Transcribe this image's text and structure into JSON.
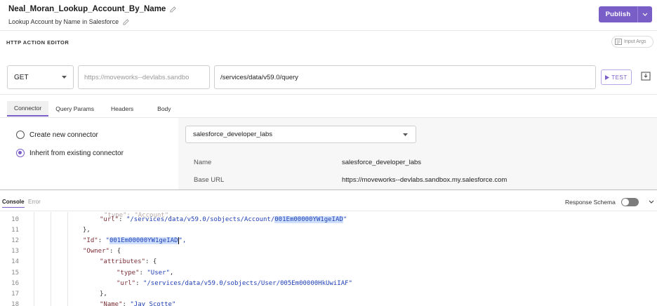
{
  "header": {
    "title": "Neal_Moran_Lookup_Account_By_Name",
    "subtitle": "Lookup Account by Name in Salesforce",
    "publish_label": "Publish"
  },
  "editor": {
    "label": "HTTP ACTION EDITOR",
    "input_args_label": "Input Args",
    "method": "GET",
    "base_url": "https://moveworks--devlabs.sandbo",
    "path": "/services/data/v59.0/query",
    "test_label": "TEST"
  },
  "tabs": [
    "Connector",
    "Query Params",
    "Headers",
    "Body"
  ],
  "connector": {
    "option_new": "Create new connector",
    "option_existing": "Inherit from existing connector",
    "selected_connector": "salesforce_developer_labs",
    "fields": [
      {
        "key": "Name",
        "value": "salesforce_developer_labs"
      },
      {
        "key": "Base URL",
        "value": "https://moveworks--devlabs.sandbox.my.salesforce.com"
      }
    ]
  },
  "console": {
    "tab_console": "Console",
    "tab_error": "Error",
    "response_schema_label": "Response Schema",
    "lines": [
      {
        "n": "10",
        "indent": 2,
        "key": "\"url\"",
        "sep": ": ",
        "val": "\"/services/data/v59.0/sobjects/Account/",
        "hl": "001Em00000YW1geIAD",
        "tail": "\""
      },
      {
        "n": "11",
        "indent": 1,
        "punct": "},"
      },
      {
        "n": "12",
        "indent": 1,
        "key": "\"Id\"",
        "sep": ": ",
        "val": "\"",
        "hl": "001Em00000YW1geIAD",
        "tail": "\","
      },
      {
        "n": "13",
        "indent": 1,
        "key": "\"Owner\"",
        "sep": ": ",
        "punct": "{"
      },
      {
        "n": "14",
        "indent": 2,
        "key": "\"attributes\"",
        "sep": ": ",
        "punct": "{"
      },
      {
        "n": "15",
        "indent": 3,
        "key": "\"type\"",
        "sep": ": ",
        "val": "\"User\"",
        "tail": ","
      },
      {
        "n": "16",
        "indent": 3,
        "key": "\"url\"",
        "sep": ": ",
        "val": "\"/services/data/v59.0/sobjects/User/005Em00000HkUwiIAF\""
      },
      {
        "n": "17",
        "indent": 2,
        "punct": "},"
      },
      {
        "n": "18",
        "indent": 2,
        "key": "\"Name\"",
        "sep": ": ",
        "val": "\"Jay Scotte\""
      }
    ]
  },
  "icons": {
    "pencil": "pencil-icon",
    "caret": "chevron-down-icon",
    "play": "play-icon",
    "save": "save-icon",
    "input_args": "input-args-icon"
  },
  "colors": {
    "accent": "#7a5ec8",
    "json_key": "#7b2e36",
    "json_string": "#1f3fb5",
    "selection": "#cfe0ff"
  }
}
